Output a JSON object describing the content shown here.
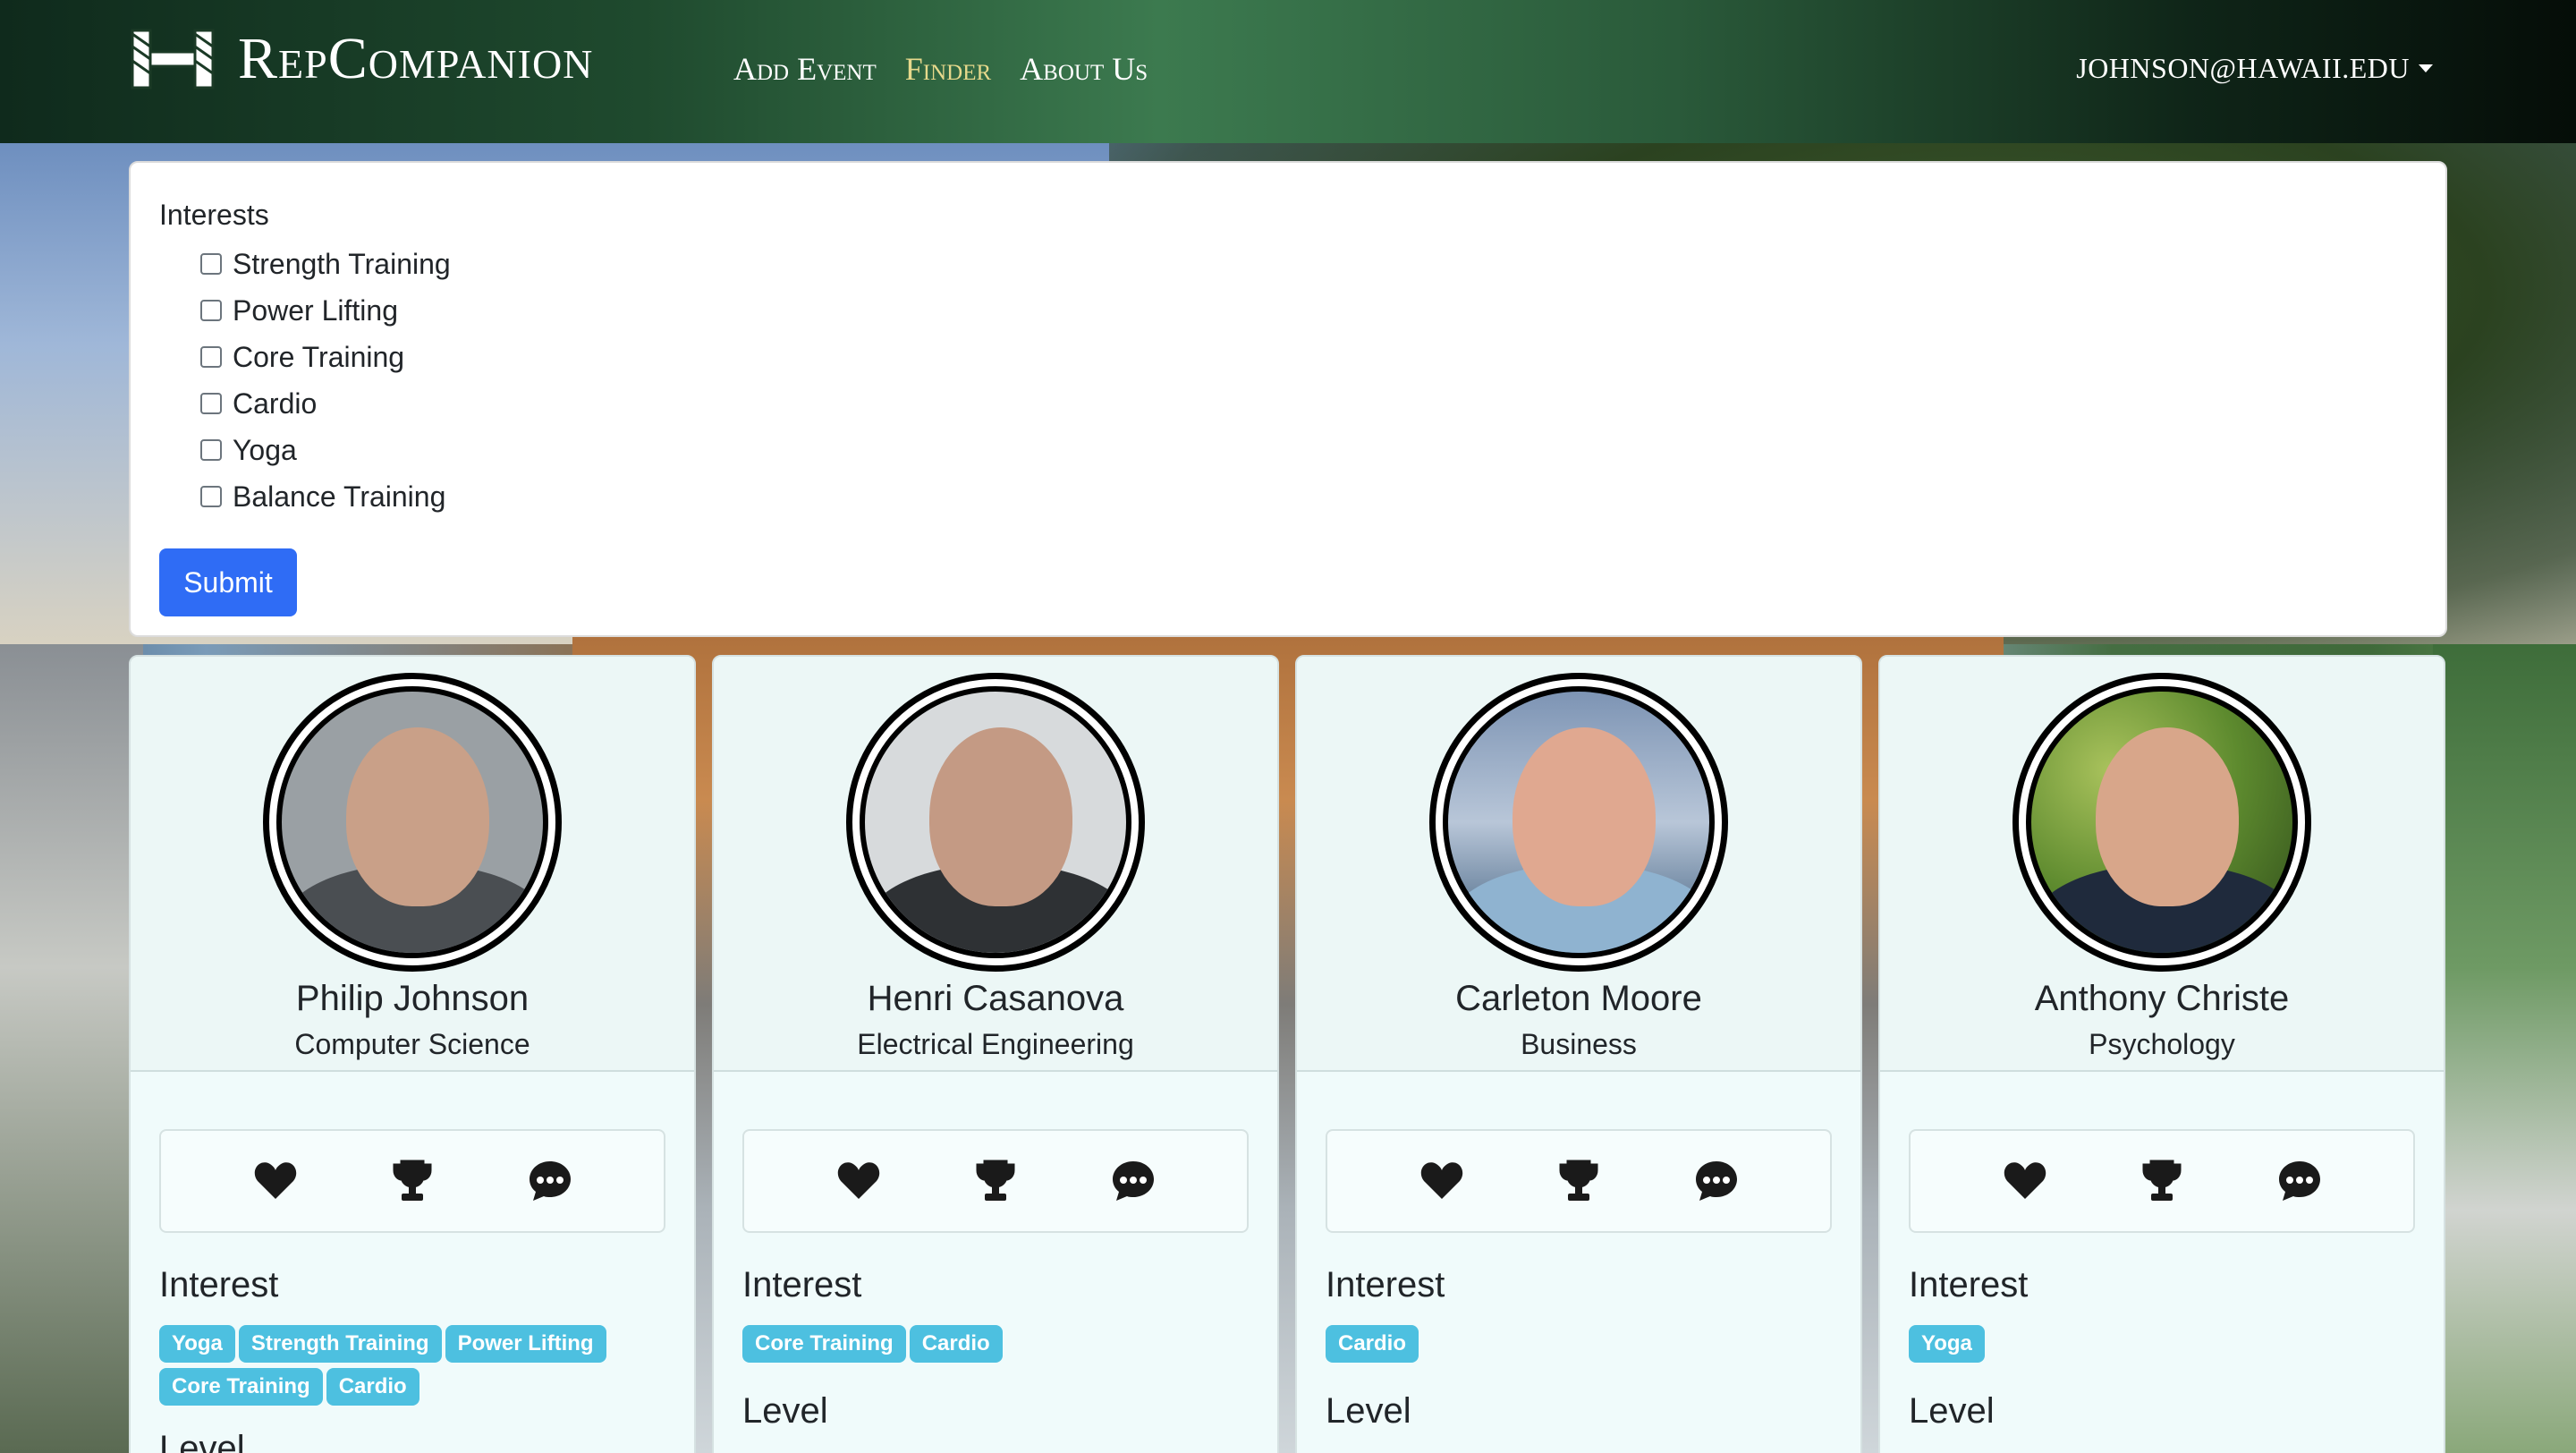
{
  "nav": {
    "brand": "RepCompanion",
    "links": [
      {
        "label": "Add Event",
        "active": false
      },
      {
        "label": "Finder",
        "active": true
      },
      {
        "label": "About Us",
        "active": false
      }
    ],
    "user": "johnson@hawaii.edu"
  },
  "filter": {
    "heading": "Interests",
    "options": [
      "Strength Training",
      "Power Lifting",
      "Core Training",
      "Cardio",
      "Yoga",
      "Balance Training"
    ],
    "submit_label": "Submit"
  },
  "colors": {
    "nav_active": "#e7d98c",
    "submit": "#2f6cf5",
    "tag": "#4dc0e0"
  },
  "profiles": [
    {
      "name": "Philip Johnson",
      "department": "Computer Science",
      "interest_heading": "Interest",
      "interests": [
        "Yoga",
        "Strength Training",
        "Power Lifting",
        "Core Training",
        "Cardio"
      ],
      "level_heading": "Level"
    },
    {
      "name": "Henri Casanova",
      "department": "Electrical Engineering",
      "interest_heading": "Interest",
      "interests": [
        "Core Training",
        "Cardio"
      ],
      "level_heading": "Level"
    },
    {
      "name": "Carleton Moore",
      "department": "Business",
      "interest_heading": "Interest",
      "interests": [
        "Cardio"
      ],
      "level_heading": "Level"
    },
    {
      "name": "Anthony Christe",
      "department": "Psychology",
      "interest_heading": "Interest",
      "interests": [
        "Yoga"
      ],
      "level_heading": "Level"
    }
  ],
  "action_icons": [
    "heart-icon",
    "trophy-icon",
    "chat-bubble-icon"
  ]
}
